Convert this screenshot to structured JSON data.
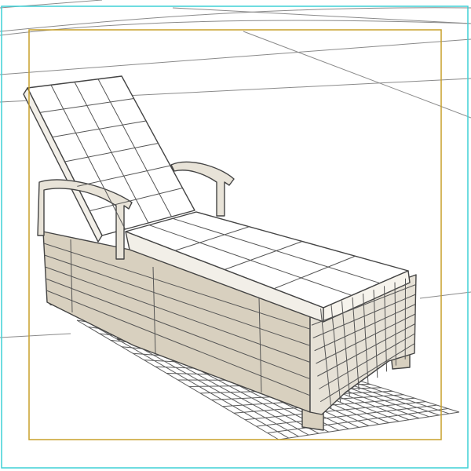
{
  "viewport": {
    "background": "#ffffff",
    "border_color": "#3fd0d6",
    "safe_frame_color": "#c8a02a",
    "wire_color": "#555555",
    "grid_color": "#5a5a5a",
    "model_fill": "#d8d0bf",
    "model_fill_light": "#e8e3d8",
    "edge_color": "#444444"
  },
  "scene": {
    "object": "chaise-lounge-wireframe",
    "shading": "wireframe-over-flat"
  }
}
